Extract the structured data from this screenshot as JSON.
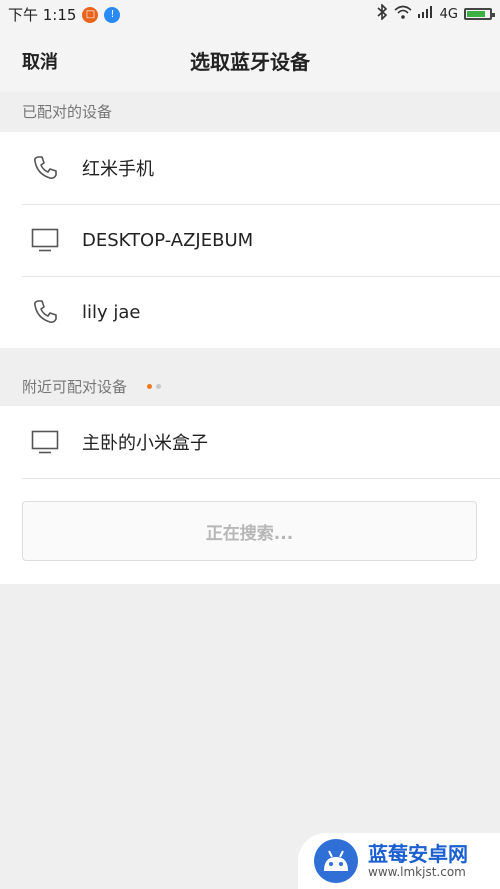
{
  "status_bar": {
    "time": "下午 1:15",
    "network": "4G",
    "battery_percent": 80,
    "colors": {
      "badge1": "#e8641b",
      "badge2": "#2a8af6",
      "battery": "#3cb043"
    }
  },
  "title_bar": {
    "cancel_label": "取消",
    "title": "选取蓝牙设备"
  },
  "paired": {
    "header": "已配对的设备",
    "devices": [
      {
        "name": "红米手机",
        "icon": "phone-icon"
      },
      {
        "name": "DESKTOP-AZJEBUM",
        "icon": "monitor-icon"
      },
      {
        "name": "lily jae",
        "icon": "phone-icon"
      }
    ]
  },
  "available": {
    "header": "附近可配对设备",
    "devices": [
      {
        "name": "主卧的小米盒子",
        "icon": "monitor-icon"
      }
    ],
    "searching_label": "正在搜索..."
  },
  "watermark": {
    "title": "蓝莓安卓网",
    "url": "www.lmkjst.com"
  }
}
